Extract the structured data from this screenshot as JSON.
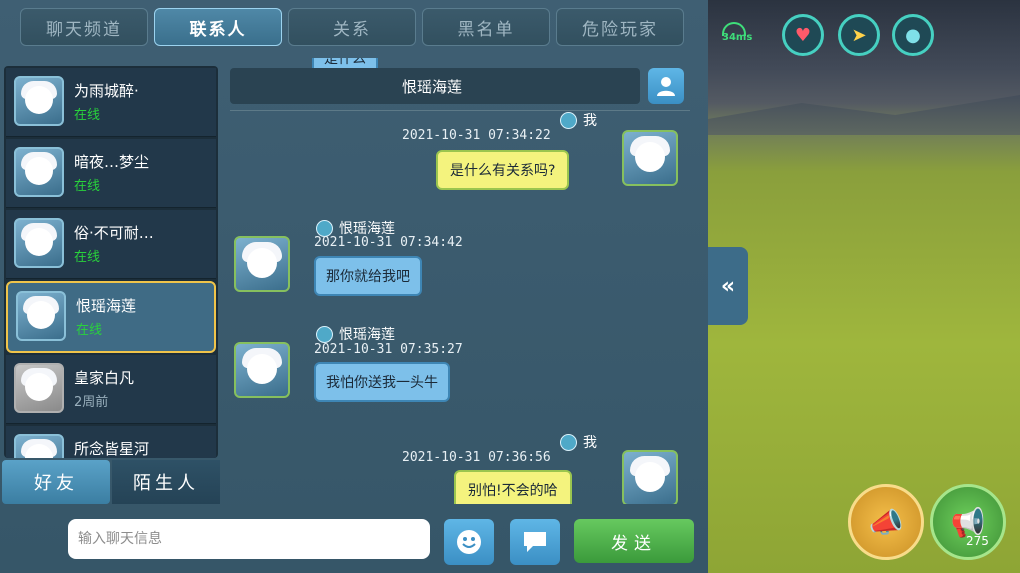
{
  "top_tabs": [
    {
      "label": "聊天频道",
      "active": false
    },
    {
      "label": "联系人",
      "active": true
    },
    {
      "label": "关系",
      "active": false
    },
    {
      "label": "黑名单",
      "active": false
    },
    {
      "label": "危险玩家",
      "active": false
    }
  ],
  "contacts": [
    {
      "name": "为雨城醉·",
      "status": "在线",
      "online": true
    },
    {
      "name": "暗夜…梦尘",
      "status": "在线",
      "online": true
    },
    {
      "name": "俗·不可耐…",
      "status": "在线",
      "online": true
    },
    {
      "name": "恨瑶海莲",
      "status": "在线",
      "online": true,
      "selected": true
    },
    {
      "name": "皇家白凡",
      "status": "2周前",
      "online": false
    },
    {
      "name": "所念皆星河",
      "status": "",
      "online": false
    }
  ],
  "bottom_tabs": {
    "friends": "好友",
    "strangers": "陌生人"
  },
  "chat": {
    "title": "恨瑶海莲",
    "partial_top_bubble": "是什么",
    "messages": [
      {
        "side": "right",
        "sender": "我",
        "time": "2021-10-31  07:34:22",
        "text": "是什么有关系吗?"
      },
      {
        "side": "left",
        "sender": "恨瑶海莲",
        "time": "2021-10-31  07:34:42",
        "text": "那你就给我吧"
      },
      {
        "side": "left",
        "sender": "恨瑶海莲",
        "time": "2021-10-31  07:35:27",
        "text": "我怕你送我一头牛"
      },
      {
        "side": "right",
        "sender": "我",
        "time": "2021-10-31  07:36:56",
        "text": "别怕!不会的哈"
      }
    ]
  },
  "input": {
    "placeholder": "输入聊天信息",
    "send_label": "发送"
  },
  "hud": {
    "ping": "34ms",
    "horn_count": "275"
  },
  "colors": {
    "online": "#29d23c",
    "accent": "#3b8fc4",
    "send": "#3b9a3b"
  }
}
